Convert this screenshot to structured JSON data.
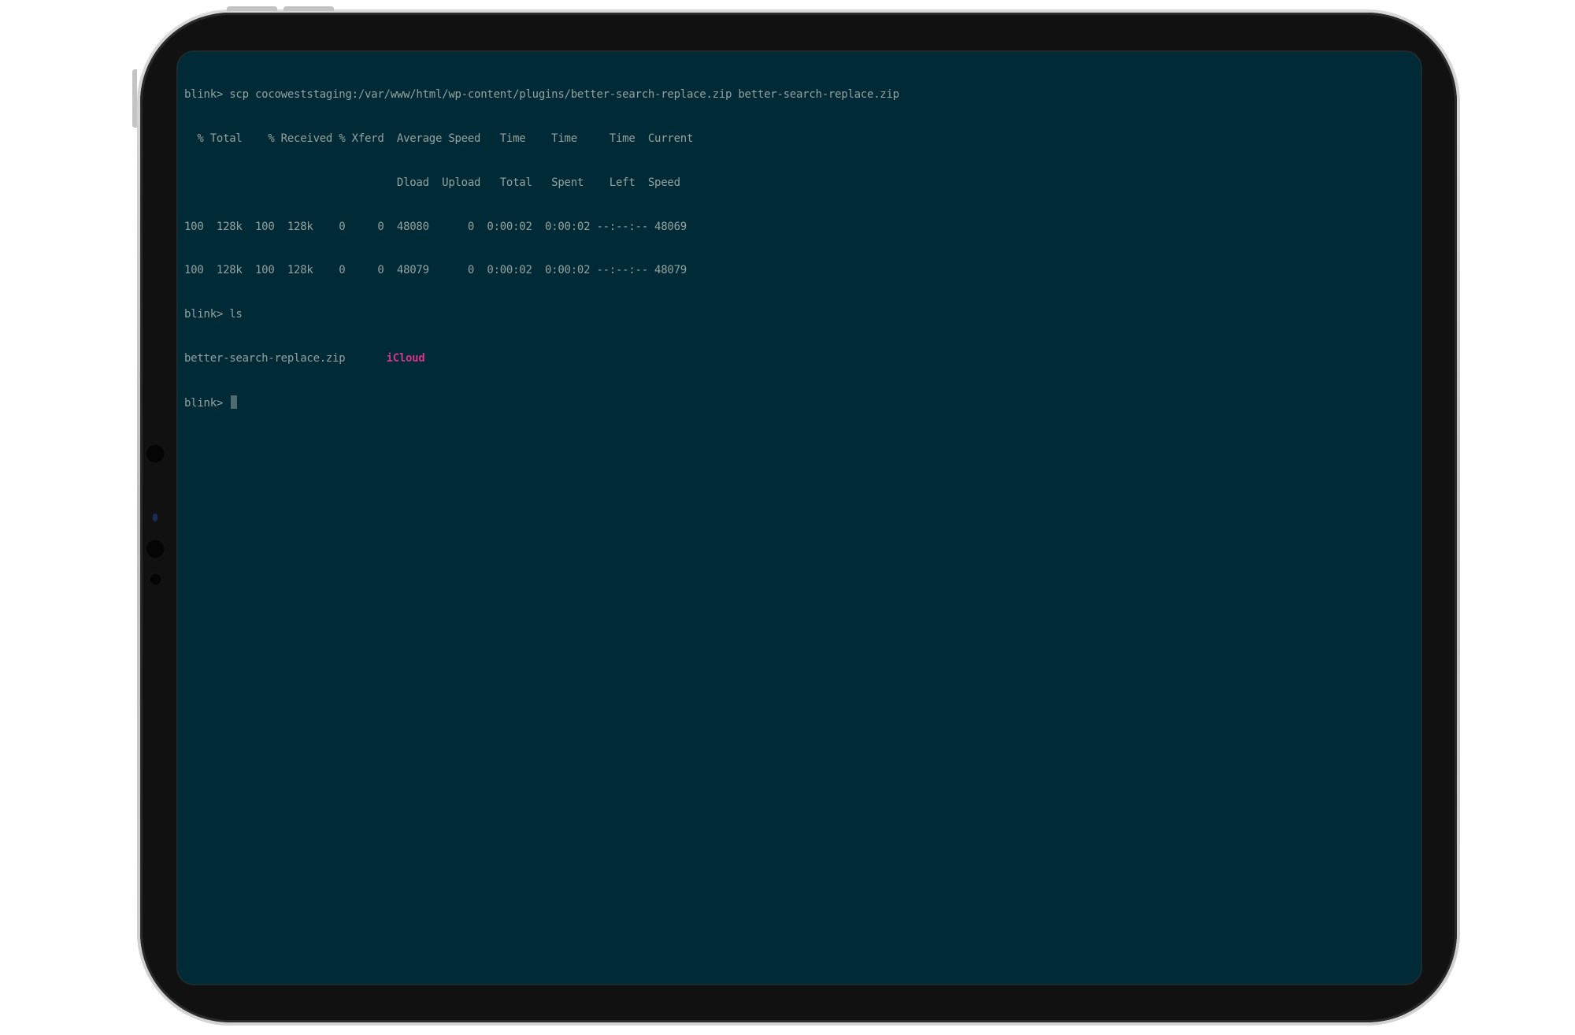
{
  "terminal": {
    "lines": [
      "blink> scp cocoweststaging:/var/www/html/wp-content/plugins/better-search-replace.zip better-search-replace.zip",
      "  % Total    % Received % Xferd  Average Speed   Time    Time     Time  Current",
      "                                 Dload  Upload   Total   Spent    Left  Speed",
      "100  128k  100  128k    0     0  48080      0  0:00:02  0:00:02 --:--:-- 48069",
      "100  128k  100  128k    0     0  48079      0  0:00:02  0:00:02 --:--:-- 48079",
      "blink> ls"
    ],
    "ls_output": {
      "file": "better-search-replace.zip",
      "folder": "iCloud"
    },
    "prompt": "blink> "
  },
  "colors": {
    "background": "#002b36",
    "foreground": "#93a1a1",
    "directory": "#d33682",
    "cursor": "#4f6b70"
  }
}
